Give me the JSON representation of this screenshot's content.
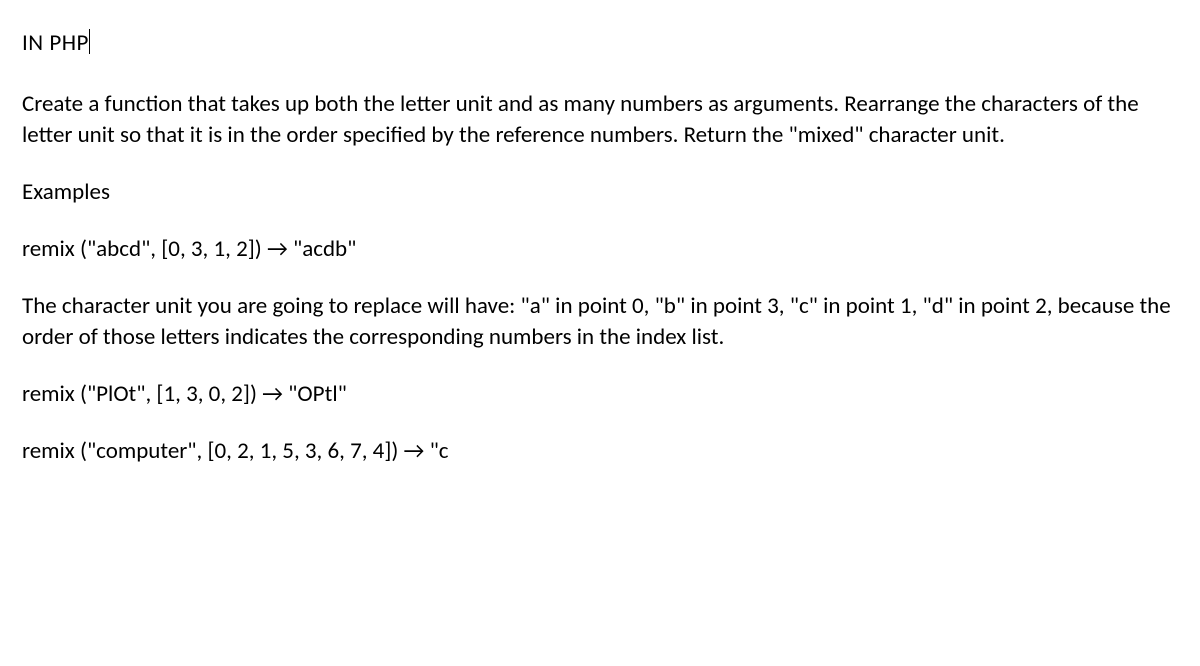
{
  "heading": "IN PHP",
  "intro": "Create a function that takes up both the letter unit and as many numbers as arguments. Rearrange the characters of the letter unit so that it is in the order specified by the reference numbers. Return the \"mixed\" character unit.",
  "examples_label": "Examples",
  "example1": "remix (\"abcd\", [0, 3, 1, 2]) → \"acdb\"",
  "explanation": "The character unit you are going to replace will have: \"a\" in point 0, \"b\" in point 3, \"c\" in point 1, \"d\" in point 2, because the order of those letters indicates the corresponding numbers in the index list.",
  "example2": "remix (\"PlOt\", [1, 3, 0, 2]) → \"OPtl\"",
  "example3": "remix (\"computer\", [0, 2, 1, 5, 3, 6, 7, 4]) → \"c"
}
